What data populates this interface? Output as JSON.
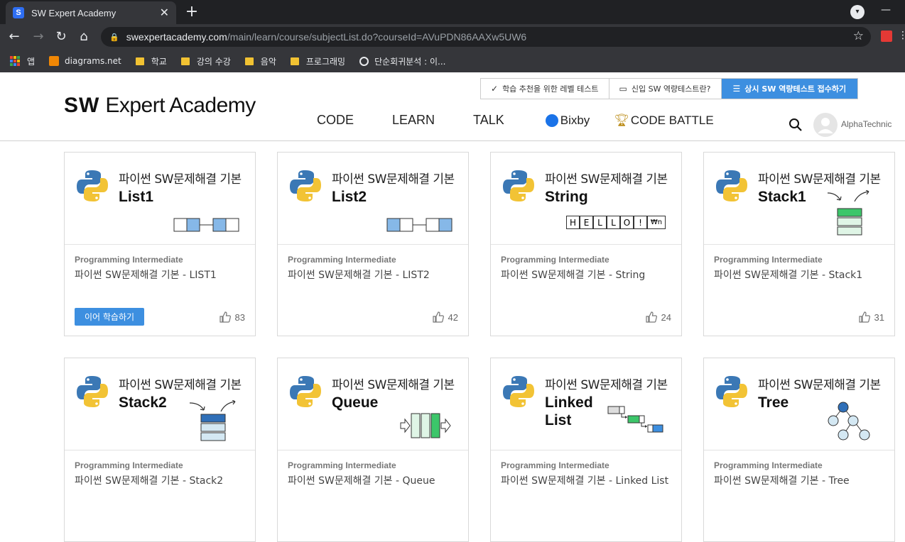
{
  "browser": {
    "tab_title": "SW Expert Academy",
    "tab_favicon": "S",
    "new_tab": "+",
    "url_host": "swexpertacademy.com",
    "url_path": "/main/learn/course/subjectList.do?courseId=AVuPDN86AAXw5UW6",
    "bookmarks": [
      "앱",
      "diagrams.net",
      "학교",
      "강의 수강",
      "음악",
      "프로그래밍",
      "단순회귀분석 : 이..."
    ]
  },
  "header": {
    "logo_bold": "SW",
    "logo_rest": "Expert Academy",
    "top_links": {
      "level_test": "학습 추천을 위한 레벨 테스트",
      "new_sw_test": "신입 SW 역량테스트란?",
      "apply_test": "상시 SW 역량테스트 접수하기"
    },
    "nav": {
      "code": "CODE",
      "learn": "LEARN",
      "talk": "TALK",
      "bixby": "Bixby",
      "battle": "CODE BATTLE"
    },
    "username": "AlphaTechnic"
  },
  "colors": {
    "accent": "#3d8fe0",
    "cell_blue": "#86b8e8",
    "green": "#3cc66a",
    "light_green": "#dff5e6",
    "light_blue": "#d4e8f3"
  },
  "cards": [
    {
      "sub": "파이썬 SW문제해결 기본",
      "name": "List1",
      "level": "Programming Intermediate",
      "title": "파이썬 SW문제해결 기본 - LIST1",
      "likes": "83",
      "button": "이어 학습하기"
    },
    {
      "sub": "파이썬 SW문제해결 기본",
      "name": "List2",
      "level": "Programming Intermediate",
      "title": "파이썬 SW문제해결 기본 - LIST2",
      "likes": "42"
    },
    {
      "sub": "파이썬 SW문제해결 기본",
      "name": "String",
      "level": "Programming Intermediate",
      "title": "파이썬 SW문제해결 기본 - String",
      "likes": "24",
      "letters": [
        "H",
        "E",
        "L",
        "L",
        "O",
        "!",
        "₩n"
      ]
    },
    {
      "sub": "파이썬 SW문제해결 기본",
      "name": "Stack1",
      "level": "Programming Intermediate",
      "title": "파이썬 SW문제해결 기본 - Stack1",
      "likes": "31"
    },
    {
      "sub": "파이썬 SW문제해결 기본",
      "name": "Stack2",
      "level": "Programming Intermediate",
      "title": "파이썬 SW문제해결 기본 - Stack2"
    },
    {
      "sub": "파이썬 SW문제해결 기본",
      "name": "Queue",
      "level": "Programming Intermediate",
      "title": "파이썬 SW문제해결 기본 - Queue"
    },
    {
      "sub": "파이썬 SW문제해결 기본",
      "name": "Linked List",
      "level": "Programming Intermediate",
      "title": "파이썬 SW문제해결 기본 - Linked List"
    },
    {
      "sub": "파이썬 SW문제해결 기본",
      "name": "Tree",
      "level": "Programming Intermediate",
      "title": "파이썬 SW문제해결 기본 - Tree"
    }
  ]
}
